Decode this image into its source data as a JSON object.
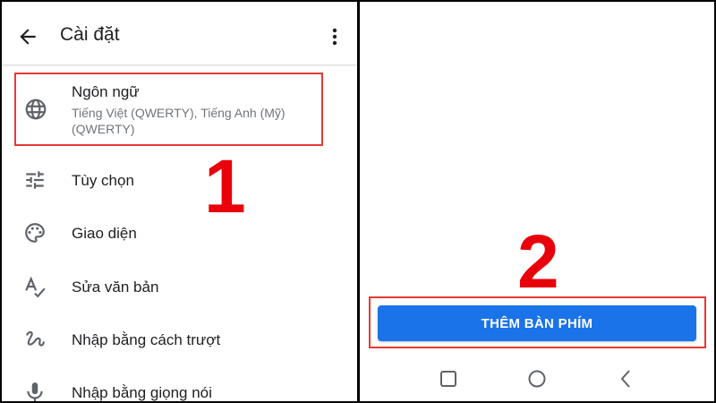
{
  "appbar": {
    "title": "Cài đặt"
  },
  "menu": {
    "language": {
      "title": "Ngôn ngữ",
      "subtitle": "Tiếng Việt (QWERTY), Tiếng Anh (Mỹ) (QWERTY)"
    },
    "items": [
      {
        "label": "Tùy chọn",
        "icon": "tune-icon"
      },
      {
        "label": "Giao diện",
        "icon": "palette-icon"
      },
      {
        "label": "Sửa văn bản",
        "icon": "spellcheck-icon"
      },
      {
        "label": "Nhập bằng cách trượt",
        "icon": "gesture-icon"
      },
      {
        "label": "Nhập bằng giọng nói",
        "icon": "mic-icon"
      }
    ]
  },
  "steps": {
    "one": "1",
    "two": "2"
  },
  "action": {
    "add_keyboard": "THÊM BÀN PHÍM"
  },
  "colors": {
    "accent": "#1a73e8",
    "highlight": "#e53935",
    "step": "#e8000b"
  }
}
